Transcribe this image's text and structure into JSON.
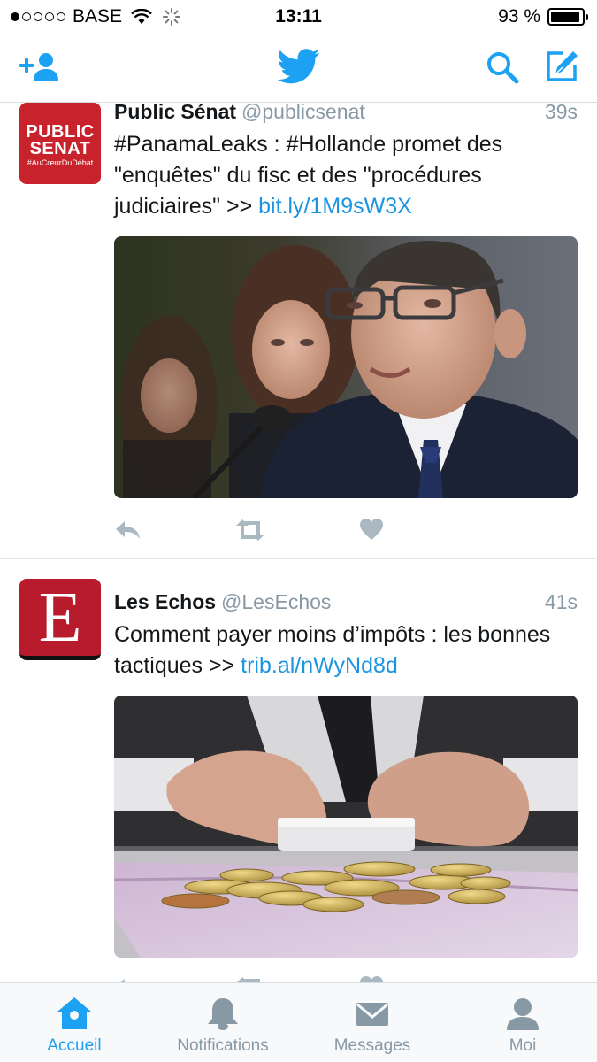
{
  "status_bar": {
    "carrier": "BASE",
    "time": "13:11",
    "battery": "93 %",
    "battery_level": 0.93,
    "signal_bars": 1
  },
  "navbar": {
    "left_icon": "add-user-icon",
    "center_icon": "twitter-bird-icon",
    "right_icons": [
      "search-icon",
      "compose-icon"
    ],
    "accent_color": "#1da1f2"
  },
  "tweets": [
    {
      "name": "Public Sénat",
      "handle": "@publicsenat",
      "time": "39s",
      "avatar": {
        "line1": "PUBLIC",
        "line2": "SENAT",
        "line3": "#AuCœurDuDébat",
        "color": "#c8232c"
      },
      "text": "#PanamaLeaks : #Hollande promet des \"enquêtes\" du fisc et des \"procédures judiciaires\" >> ",
      "link": "bit.ly/1M9sW3X",
      "media": "photo"
    },
    {
      "name": "Les Echos",
      "handle": "@LesEchos",
      "time": "41s",
      "avatar": {
        "letter": "E",
        "color": "#b81b2c"
      },
      "text": "Comment payer moins d’impôts : les bonnes tactiques >> ",
      "link": "trib.al/nWyNd8d",
      "media": "photo"
    }
  ],
  "actions": [
    "reply-icon",
    "retweet-icon",
    "like-icon"
  ],
  "tabbar": {
    "tabs": [
      {
        "label": "Accueil",
        "icon": "home-icon",
        "active": true
      },
      {
        "label": "Notifications",
        "icon": "bell-icon",
        "active": false
      },
      {
        "label": "Messages",
        "icon": "envelope-icon",
        "active": false
      },
      {
        "label": "Moi",
        "icon": "person-icon",
        "active": false
      }
    ]
  },
  "colors": {
    "link": "#1b95e0",
    "muted": "#8899a6",
    "action_icon": "#aab8c2"
  }
}
